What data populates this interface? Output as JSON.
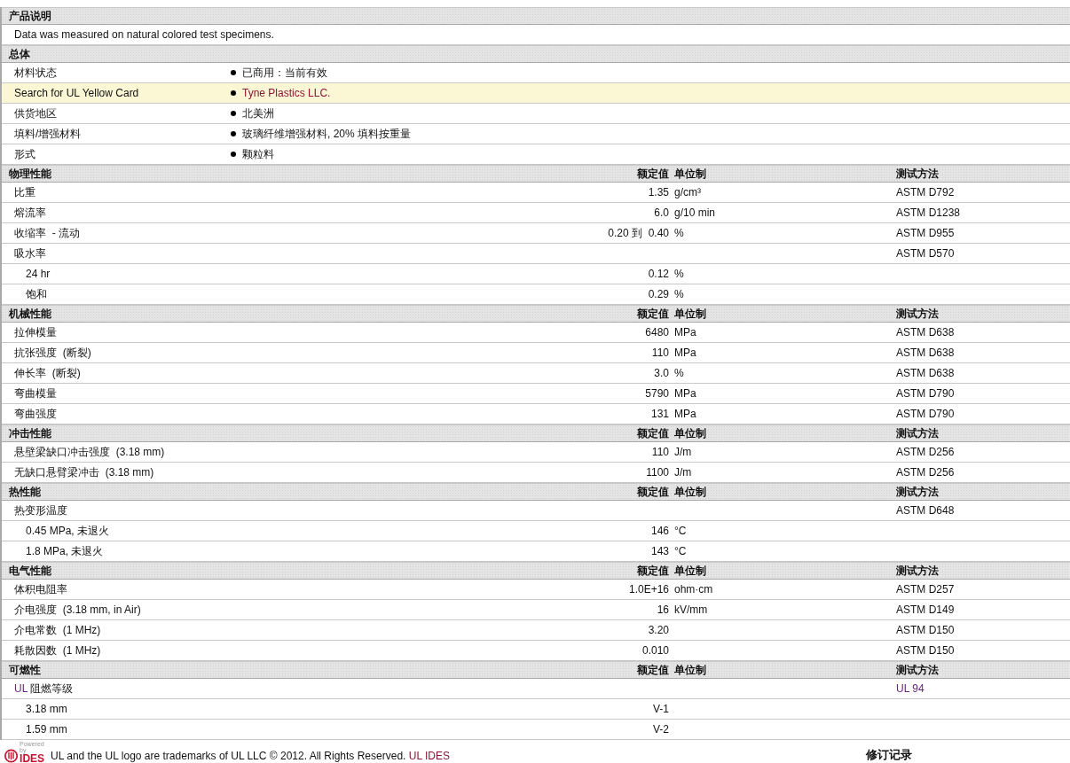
{
  "sections": [
    {
      "title": "产品说明",
      "rows": [
        {
          "kind": "note",
          "text": "Data was measured on natural colored test specimens."
        }
      ]
    },
    {
      "title": "总体",
      "rows": [
        {
          "kind": "bullet",
          "label": "材料状态",
          "value": "已商用：当前有效",
          "highlighted": false,
          "link": false
        },
        {
          "kind": "bullet",
          "label": "Search for UL Yellow Card",
          "value": "Tyne Plastics LLC.",
          "highlighted": true,
          "link": true
        },
        {
          "kind": "bullet",
          "label": "供货地区",
          "value": "北美洲",
          "highlighted": false,
          "link": false
        },
        {
          "kind": "bullet",
          "label": "填料/增强材料",
          "value": "玻璃纤维增强材料, 20% 填料按重量",
          "highlighted": false,
          "link": false
        },
        {
          "kind": "bullet",
          "label": "形式",
          "value": "颗粒料",
          "highlighted": false,
          "link": false
        }
      ]
    },
    {
      "title": "物理性能",
      "columns": {
        "value": "额定值",
        "unit": "单位制",
        "method": "测试方法"
      },
      "rows": [
        {
          "kind": "property",
          "label": "比重",
          "value": "1.35",
          "unit": "g/cm³",
          "method": "ASTM D792",
          "method_link": false
        },
        {
          "kind": "property",
          "label": "熔流率",
          "value": "6.0",
          "unit": "g/10 min",
          "method": "ASTM D1238",
          "method_link": false
        },
        {
          "kind": "property",
          "label": "收缩率  - 流动",
          "value": "0.20 到  0.40",
          "unit": "%",
          "method": "ASTM D955",
          "method_link": false
        },
        {
          "kind": "property",
          "label": "吸水率",
          "method": "ASTM D570",
          "method_link": false,
          "children": [
            {
              "kind": "property",
              "label": "24 hr",
              "value": "0.12",
              "unit": "%"
            },
            {
              "kind": "property",
              "label": "饱和",
              "value": "0.29",
              "unit": "%"
            }
          ]
        }
      ]
    },
    {
      "title": "机械性能",
      "columns": {
        "value": "额定值",
        "unit": "单位制",
        "method": "测试方法"
      },
      "rows": [
        {
          "kind": "property",
          "label": "拉伸模量",
          "value": "6480",
          "unit": "MPa",
          "method": "ASTM D638",
          "method_link": false
        },
        {
          "kind": "property",
          "label": "抗张强度  (断裂)",
          "value": "110",
          "unit": "MPa",
          "method": "ASTM D638",
          "method_link": false
        },
        {
          "kind": "property",
          "label": "伸长率  (断裂)",
          "value": "3.0",
          "unit": "%",
          "method": "ASTM D638",
          "method_link": false
        },
        {
          "kind": "property",
          "label": "弯曲模量",
          "value": "5790",
          "unit": "MPa",
          "method": "ASTM D790",
          "method_link": false
        },
        {
          "kind": "property",
          "label": "弯曲强度",
          "value": "131",
          "unit": "MPa",
          "method": "ASTM D790",
          "method_link": false
        }
      ]
    },
    {
      "title": "冲击性能",
      "columns": {
        "value": "额定值",
        "unit": "单位制",
        "method": "测试方法"
      },
      "rows": [
        {
          "kind": "property",
          "label": "悬壁梁缺口冲击强度  (3.18 mm)",
          "value": "110",
          "unit": "J/m",
          "method": "ASTM D256",
          "method_link": false
        },
        {
          "kind": "property",
          "label": "无缺口悬臂梁冲击  (3.18 mm)",
          "value": "1100",
          "unit": "J/m",
          "method": "ASTM D256",
          "method_link": false
        }
      ]
    },
    {
      "title": "热性能",
      "columns": {
        "value": "额定值",
        "unit": "单位制",
        "method": "测试方法"
      },
      "rows": [
        {
          "kind": "property",
          "label": "热变形温度",
          "method": "ASTM D648",
          "method_link": false,
          "children": [
            {
              "kind": "property",
              "label": "0.45 MPa, 未退火",
              "value": "146",
              "unit": "°C"
            },
            {
              "kind": "property",
              "label": "1.8 MPa, 未退火",
              "value": "143",
              "unit": "°C"
            }
          ]
        }
      ]
    },
    {
      "title": "电气性能",
      "columns": {
        "value": "额定值",
        "unit": "单位制",
        "method": "测试方法"
      },
      "rows": [
        {
          "kind": "property",
          "label": "体积电阻率",
          "value": "1.0E+16",
          "unit": "ohm·cm",
          "method": "ASTM D257",
          "method_link": false
        },
        {
          "kind": "property",
          "label": "介电强度  (3.18 mm, in Air)",
          "value": "16",
          "unit": "kV/mm",
          "method": "ASTM D149",
          "method_link": false
        },
        {
          "kind": "property",
          "label": "介电常数  (1 MHz)",
          "value": "3.20",
          "method": "ASTM D150",
          "method_link": false
        },
        {
          "kind": "property",
          "label": "耗散因数  (1 MHz)",
          "value": "0.010",
          "method": "ASTM D150",
          "method_link": false
        }
      ]
    },
    {
      "title": "可燃性",
      "columns": {
        "value": "额定值",
        "unit": "单位制",
        "method": "测试方法"
      },
      "rows": [
        {
          "kind": "property",
          "label_link": "UL",
          "label": "阻燃等级",
          "method": "UL 94",
          "method_link": true,
          "children": [
            {
              "kind": "property",
              "label": "3.18 mm",
              "value": "V-1"
            },
            {
              "kind": "property",
              "label": "1.59 mm",
              "value": "V-2"
            }
          ]
        }
      ]
    }
  ],
  "footer": {
    "logo_caption": "Powered by",
    "logo_name": "IDES",
    "text": "UL and the UL logo are trademarks of UL LLC © 2012. All Rights Reserved.",
    "link": "UL IDES",
    "revision": "修订记录"
  }
}
